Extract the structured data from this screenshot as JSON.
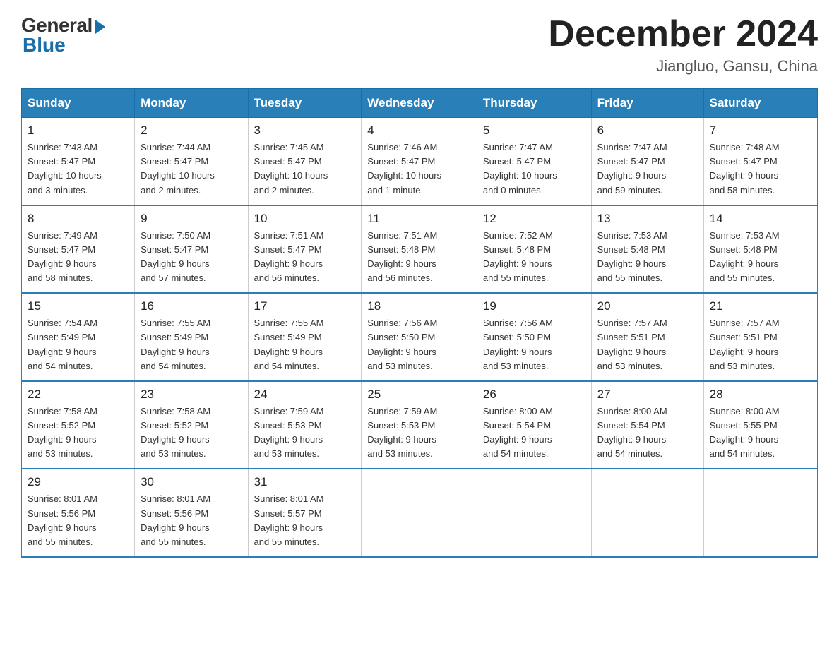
{
  "logo": {
    "general": "General",
    "blue": "Blue"
  },
  "title": "December 2024",
  "location": "Jiangluo, Gansu, China",
  "weekdays": [
    "Sunday",
    "Monday",
    "Tuesday",
    "Wednesday",
    "Thursday",
    "Friday",
    "Saturday"
  ],
  "weeks": [
    [
      {
        "day": "1",
        "info": "Sunrise: 7:43 AM\nSunset: 5:47 PM\nDaylight: 10 hours\nand 3 minutes."
      },
      {
        "day": "2",
        "info": "Sunrise: 7:44 AM\nSunset: 5:47 PM\nDaylight: 10 hours\nand 2 minutes."
      },
      {
        "day": "3",
        "info": "Sunrise: 7:45 AM\nSunset: 5:47 PM\nDaylight: 10 hours\nand 2 minutes."
      },
      {
        "day": "4",
        "info": "Sunrise: 7:46 AM\nSunset: 5:47 PM\nDaylight: 10 hours\nand 1 minute."
      },
      {
        "day": "5",
        "info": "Sunrise: 7:47 AM\nSunset: 5:47 PM\nDaylight: 10 hours\nand 0 minutes."
      },
      {
        "day": "6",
        "info": "Sunrise: 7:47 AM\nSunset: 5:47 PM\nDaylight: 9 hours\nand 59 minutes."
      },
      {
        "day": "7",
        "info": "Sunrise: 7:48 AM\nSunset: 5:47 PM\nDaylight: 9 hours\nand 58 minutes."
      }
    ],
    [
      {
        "day": "8",
        "info": "Sunrise: 7:49 AM\nSunset: 5:47 PM\nDaylight: 9 hours\nand 58 minutes."
      },
      {
        "day": "9",
        "info": "Sunrise: 7:50 AM\nSunset: 5:47 PM\nDaylight: 9 hours\nand 57 minutes."
      },
      {
        "day": "10",
        "info": "Sunrise: 7:51 AM\nSunset: 5:47 PM\nDaylight: 9 hours\nand 56 minutes."
      },
      {
        "day": "11",
        "info": "Sunrise: 7:51 AM\nSunset: 5:48 PM\nDaylight: 9 hours\nand 56 minutes."
      },
      {
        "day": "12",
        "info": "Sunrise: 7:52 AM\nSunset: 5:48 PM\nDaylight: 9 hours\nand 55 minutes."
      },
      {
        "day": "13",
        "info": "Sunrise: 7:53 AM\nSunset: 5:48 PM\nDaylight: 9 hours\nand 55 minutes."
      },
      {
        "day": "14",
        "info": "Sunrise: 7:53 AM\nSunset: 5:48 PM\nDaylight: 9 hours\nand 55 minutes."
      }
    ],
    [
      {
        "day": "15",
        "info": "Sunrise: 7:54 AM\nSunset: 5:49 PM\nDaylight: 9 hours\nand 54 minutes."
      },
      {
        "day": "16",
        "info": "Sunrise: 7:55 AM\nSunset: 5:49 PM\nDaylight: 9 hours\nand 54 minutes."
      },
      {
        "day": "17",
        "info": "Sunrise: 7:55 AM\nSunset: 5:49 PM\nDaylight: 9 hours\nand 54 minutes."
      },
      {
        "day": "18",
        "info": "Sunrise: 7:56 AM\nSunset: 5:50 PM\nDaylight: 9 hours\nand 53 minutes."
      },
      {
        "day": "19",
        "info": "Sunrise: 7:56 AM\nSunset: 5:50 PM\nDaylight: 9 hours\nand 53 minutes."
      },
      {
        "day": "20",
        "info": "Sunrise: 7:57 AM\nSunset: 5:51 PM\nDaylight: 9 hours\nand 53 minutes."
      },
      {
        "day": "21",
        "info": "Sunrise: 7:57 AM\nSunset: 5:51 PM\nDaylight: 9 hours\nand 53 minutes."
      }
    ],
    [
      {
        "day": "22",
        "info": "Sunrise: 7:58 AM\nSunset: 5:52 PM\nDaylight: 9 hours\nand 53 minutes."
      },
      {
        "day": "23",
        "info": "Sunrise: 7:58 AM\nSunset: 5:52 PM\nDaylight: 9 hours\nand 53 minutes."
      },
      {
        "day": "24",
        "info": "Sunrise: 7:59 AM\nSunset: 5:53 PM\nDaylight: 9 hours\nand 53 minutes."
      },
      {
        "day": "25",
        "info": "Sunrise: 7:59 AM\nSunset: 5:53 PM\nDaylight: 9 hours\nand 53 minutes."
      },
      {
        "day": "26",
        "info": "Sunrise: 8:00 AM\nSunset: 5:54 PM\nDaylight: 9 hours\nand 54 minutes."
      },
      {
        "day": "27",
        "info": "Sunrise: 8:00 AM\nSunset: 5:54 PM\nDaylight: 9 hours\nand 54 minutes."
      },
      {
        "day": "28",
        "info": "Sunrise: 8:00 AM\nSunset: 5:55 PM\nDaylight: 9 hours\nand 54 minutes."
      }
    ],
    [
      {
        "day": "29",
        "info": "Sunrise: 8:01 AM\nSunset: 5:56 PM\nDaylight: 9 hours\nand 55 minutes."
      },
      {
        "day": "30",
        "info": "Sunrise: 8:01 AM\nSunset: 5:56 PM\nDaylight: 9 hours\nand 55 minutes."
      },
      {
        "day": "31",
        "info": "Sunrise: 8:01 AM\nSunset: 5:57 PM\nDaylight: 9 hours\nand 55 minutes."
      },
      {
        "day": "",
        "info": ""
      },
      {
        "day": "",
        "info": ""
      },
      {
        "day": "",
        "info": ""
      },
      {
        "day": "",
        "info": ""
      }
    ]
  ]
}
